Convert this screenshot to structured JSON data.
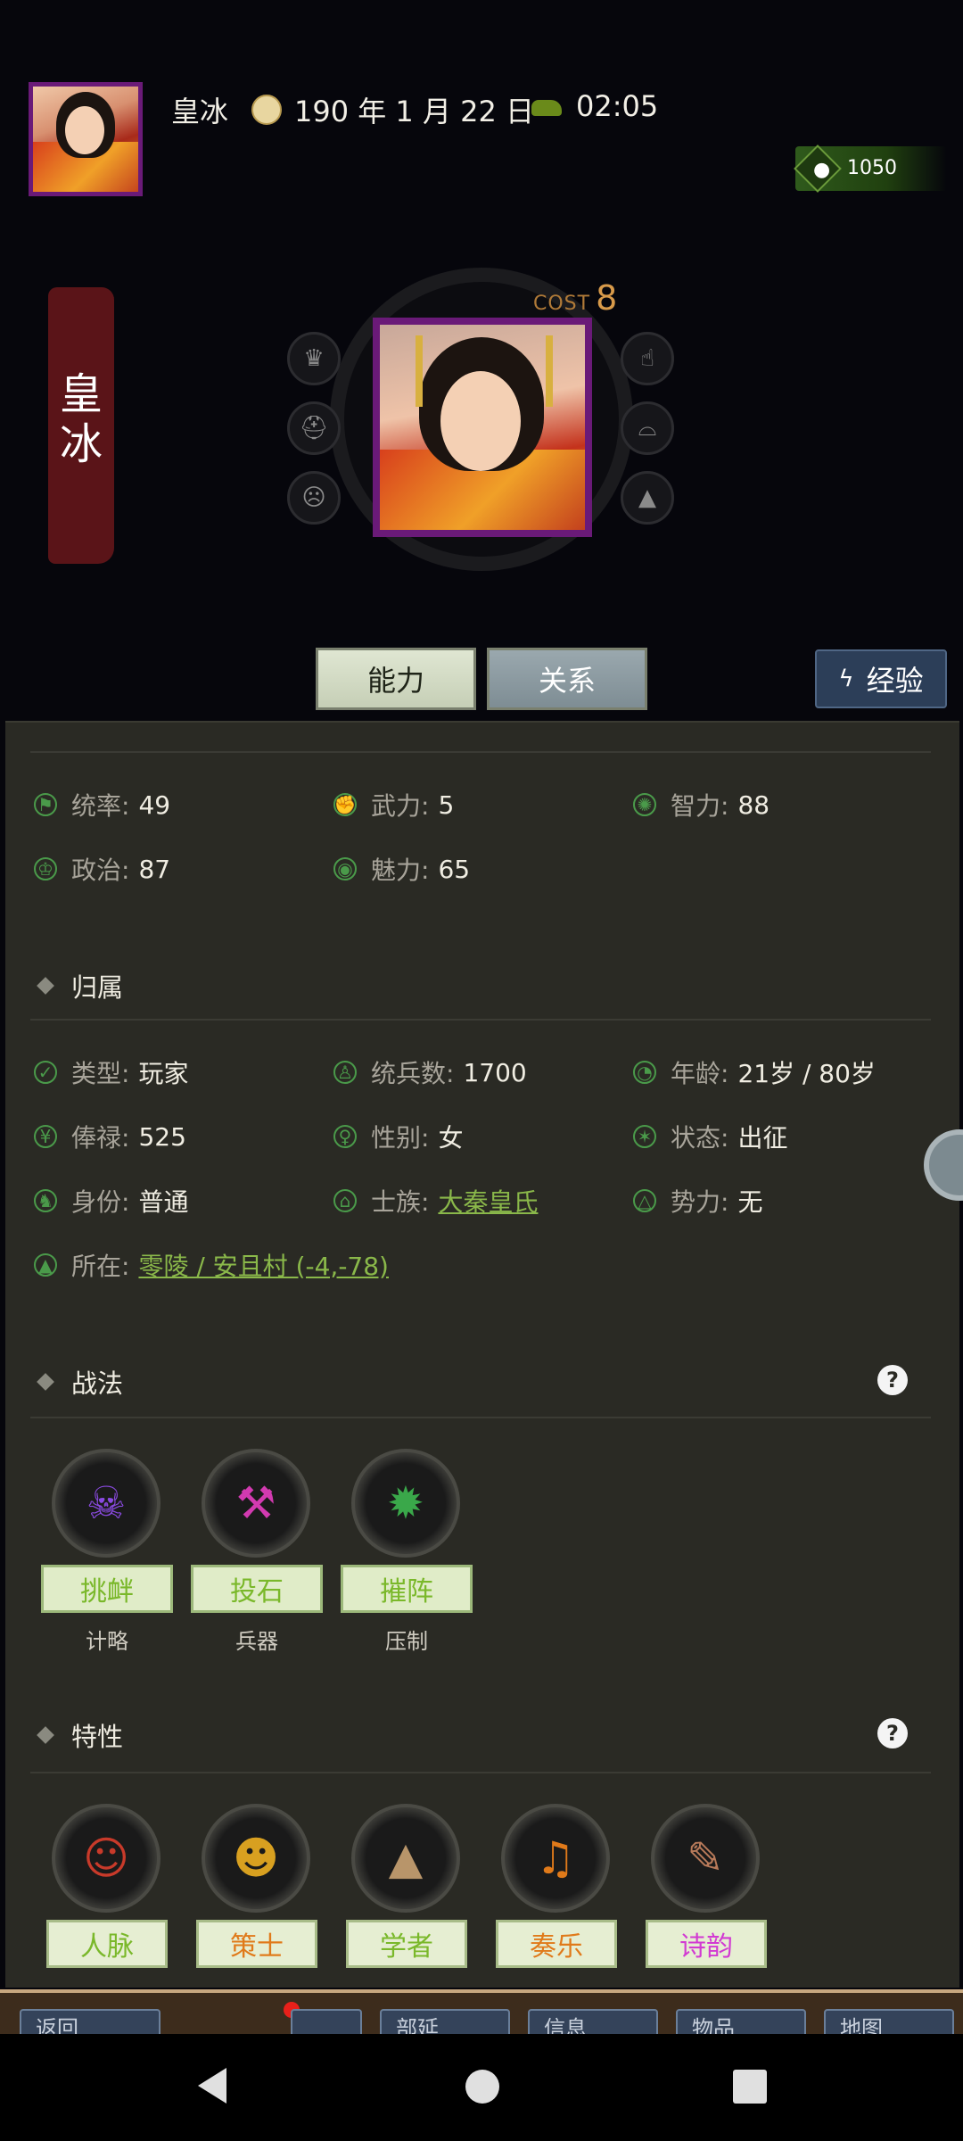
{
  "header": {
    "name": "皇冰",
    "date": "190 年 1 月 22 日",
    "time": "02:05",
    "currency": "1050"
  },
  "profile": {
    "banner_name_1": "皇",
    "banner_name_2": "冰",
    "cost_label": "COST",
    "cost_value": "8"
  },
  "tabs": {
    "ability": "能力",
    "relation": "关系",
    "experience": "经验"
  },
  "stats": [
    {
      "label": "统率:",
      "value": "49"
    },
    {
      "label": "武力:",
      "value": "5"
    },
    {
      "label": "智力:",
      "value": "88"
    },
    {
      "label": "政治:",
      "value": "87"
    },
    {
      "label": "魅力:",
      "value": "65"
    }
  ],
  "belonging": {
    "title": "归属",
    "rows": [
      {
        "label": "类型:",
        "value": "玩家"
      },
      {
        "label": "统兵数:",
        "value": "1700"
      },
      {
        "label": "年龄:",
        "value": "21岁 / 80岁"
      },
      {
        "label": "俸禄:",
        "value": "525"
      },
      {
        "label": "性别:",
        "value": "女"
      },
      {
        "label": "状态:",
        "value": "出征"
      },
      {
        "label": "身份:",
        "value": "普通"
      },
      {
        "label": "士族:",
        "value": "大秦皇氏"
      },
      {
        "label": "势力:",
        "value": "无"
      },
      {
        "label": "所在:",
        "value": "零陵 / 安且村 (-4,-78)"
      }
    ]
  },
  "tactics": {
    "title": "战法",
    "help": "?",
    "items": [
      {
        "name": "挑衅",
        "type": "计略"
      },
      {
        "name": "投石",
        "type": "兵器"
      },
      {
        "name": "摧阵",
        "type": "压制"
      }
    ]
  },
  "traits": {
    "title": "特性",
    "help": "?",
    "items": [
      {
        "name": "人脉",
        "color": "#7ab82a"
      },
      {
        "name": "策士",
        "color": "#e07a1a"
      },
      {
        "name": "学者",
        "color": "#7ab82a"
      },
      {
        "name": "奏乐",
        "color": "#e07a1a"
      },
      {
        "name": "诗韵",
        "color": "#d23ad2"
      }
    ]
  },
  "toolbar": {
    "back": "返回",
    "b2": "部延",
    "b3": "信息",
    "b4": "物品",
    "b5": "地图"
  },
  "colors": {
    "accent_green": "#8ab84a",
    "portrait_border": "#6a1a78"
  }
}
